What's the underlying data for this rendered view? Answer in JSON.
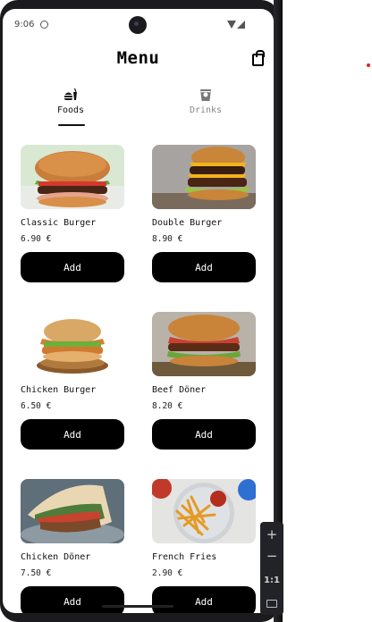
{
  "status_bar": {
    "time": "9:06"
  },
  "header": {
    "title": "Menu",
    "cart_icon": "shopping-bag-icon"
  },
  "tabs": [
    {
      "label": "Foods",
      "icon": "fast-food-icon",
      "active": true
    },
    {
      "label": "Drinks",
      "icon": "cup-icon",
      "active": false
    }
  ],
  "products": [
    {
      "name": "Classic Burger",
      "price": "6.90 €",
      "button": "Add"
    },
    {
      "name": "Double Burger",
      "price": "8.90 €",
      "button": "Add"
    },
    {
      "name": "Chicken Burger",
      "price": "6.50 €",
      "button": "Add"
    },
    {
      "name": "Beef Döner",
      "price": "8.20 €",
      "button": "Add"
    },
    {
      "name": "Chicken Döner",
      "price": "7.50 €",
      "button": "Add"
    },
    {
      "name": "French Fries",
      "price": "2.90 €",
      "button": "Add"
    }
  ],
  "emulator_toolbar": {
    "zoom_in": "+",
    "zoom_out": "−",
    "actual_size": "1:1"
  },
  "colors": {
    "accent": "#000000",
    "active_tab": "#111111",
    "inactive_tab": "#888888"
  }
}
